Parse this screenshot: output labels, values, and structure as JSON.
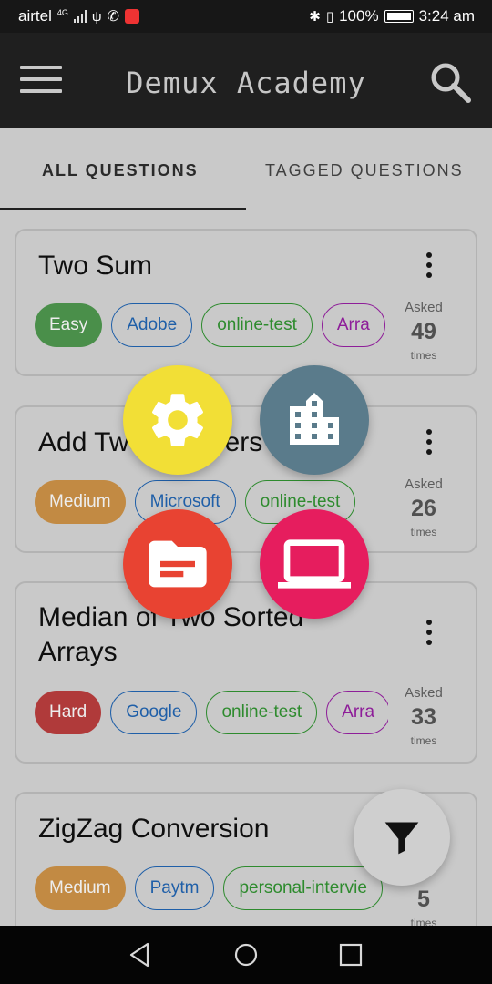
{
  "status_bar": {
    "carrier": "airtel",
    "network": "4G",
    "battery": "100%",
    "time": "3:24 am"
  },
  "app_bar": {
    "title": "Demux Academy"
  },
  "tabs": [
    {
      "label": "ALL QUESTIONS",
      "selected": true
    },
    {
      "label": "TAGGED QUESTIONS",
      "selected": false
    }
  ],
  "questions": [
    {
      "title": "Two Sum",
      "tags": [
        {
          "label": "Easy",
          "color": "#4a8f4a",
          "style": "solid"
        },
        {
          "label": "Adobe",
          "color": "#1f5fa8",
          "style": "outline"
        },
        {
          "label": "online-test",
          "color": "#2e8b2e",
          "style": "outline"
        },
        {
          "label": "Arra",
          "color": "#8e1d99",
          "style": "outline"
        }
      ],
      "asked_label": "Asked",
      "asked_count": "49",
      "asked_suffix": "times"
    },
    {
      "title": "Add Two Numbers",
      "tags": [
        {
          "label": "Medium",
          "color": "#c28a43",
          "style": "solid"
        },
        {
          "label": "Microsoft",
          "color": "#1f5fa8",
          "style": "outline"
        },
        {
          "label": "online-test",
          "color": "#2e8b2e",
          "style": "outline"
        }
      ],
      "asked_label": "Asked",
      "asked_count": "26",
      "asked_suffix": "times"
    },
    {
      "title_lines": [
        "Median of Two Sorted",
        "Arrays"
      ],
      "tags": [
        {
          "label": "Hard",
          "color": "#b03a3a",
          "style": "solid"
        },
        {
          "label": "Google",
          "color": "#1f5fa8",
          "style": "outline"
        },
        {
          "label": "online-test",
          "color": "#2e8b2e",
          "style": "outline"
        },
        {
          "label": "Arra",
          "color": "#8e1d99",
          "style": "outline"
        }
      ],
      "asked_label": "Asked",
      "asked_count": "33",
      "asked_suffix": "times"
    },
    {
      "title": "ZigZag Conversion",
      "tags": [
        {
          "label": "Medium",
          "color": "#c28a43",
          "style": "solid"
        },
        {
          "label": "Paytm",
          "color": "#1f5fa8",
          "style": "outline"
        },
        {
          "label": "personal-intervie",
          "color": "#2e8b2e",
          "style": "outline"
        }
      ],
      "asked_count": "5",
      "asked_suffix": "times"
    }
  ],
  "fab_menu": [
    {
      "icon": "gear-icon",
      "color": "#f2df36"
    },
    {
      "icon": "company-icon",
      "color": "#5a7b8b"
    },
    {
      "icon": "folder-icon",
      "color": "#e84332"
    },
    {
      "icon": "laptop-icon",
      "color": "#e61d5e"
    }
  ],
  "filter_fab": {
    "icon": "filter-icon"
  },
  "nav_bar": [
    "back-icon",
    "home-icon",
    "recents-icon"
  ]
}
